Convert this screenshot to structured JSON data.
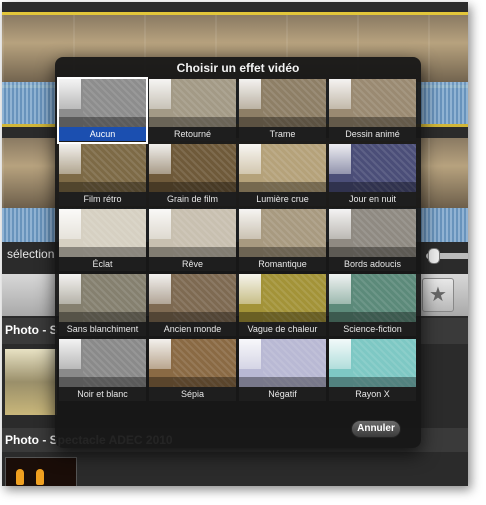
{
  "background": {
    "selection_label": "sélection",
    "section_1_title": "Photo - S",
    "section_2_title": "Photo - Spectacle ADEC 2010",
    "star_icon": "star-icon"
  },
  "dialog": {
    "title": "Choisir un effet vidéo",
    "cancel_label": "Annuler",
    "effects": [
      {
        "label": "Aucun",
        "selected": true,
        "tint": "#8d8d8d"
      },
      {
        "label": "Retourné",
        "selected": false,
        "tint": "#a39a86"
      },
      {
        "label": "Trame",
        "selected": false,
        "tint": "#8e7f66"
      },
      {
        "label": "Dessin animé",
        "selected": false,
        "tint": "#9a8a72"
      },
      {
        "label": "Film rétro",
        "selected": false,
        "tint": "#7d6a46"
      },
      {
        "label": "Grain de film",
        "selected": false,
        "tint": "#6f5a3a"
      },
      {
        "label": "Lumière crue",
        "selected": false,
        "tint": "#b5a27a"
      },
      {
        "label": "Jour en nuit",
        "selected": false,
        "tint": "#4b4e78"
      },
      {
        "label": "Éclat",
        "selected": false,
        "tint": "#d6d0c2"
      },
      {
        "label": "Rêve",
        "selected": false,
        "tint": "#c8c0b0"
      },
      {
        "label": "Romantique",
        "selected": false,
        "tint": "#a89a80"
      },
      {
        "label": "Bords adoucis",
        "selected": false,
        "tint": "#8f8a82"
      },
      {
        "label": "Sans blanchiment",
        "selected": false,
        "tint": "#85806f"
      },
      {
        "label": "Ancien monde",
        "selected": false,
        "tint": "#7e6a52"
      },
      {
        "label": "Vague de chaleur",
        "selected": false,
        "tint": "#a39338"
      },
      {
        "label": "Science-fiction",
        "selected": false,
        "tint": "#5c8a7a"
      },
      {
        "label": "Noir et blanc",
        "selected": false,
        "tint": "#8a8a8a"
      },
      {
        "label": "Sépia",
        "selected": false,
        "tint": "#8a6a44"
      },
      {
        "label": "Négatif",
        "selected": false,
        "tint": "#b9b9d4"
      },
      {
        "label": "Rayon X",
        "selected": false,
        "tint": "#7ec8c4"
      }
    ]
  }
}
